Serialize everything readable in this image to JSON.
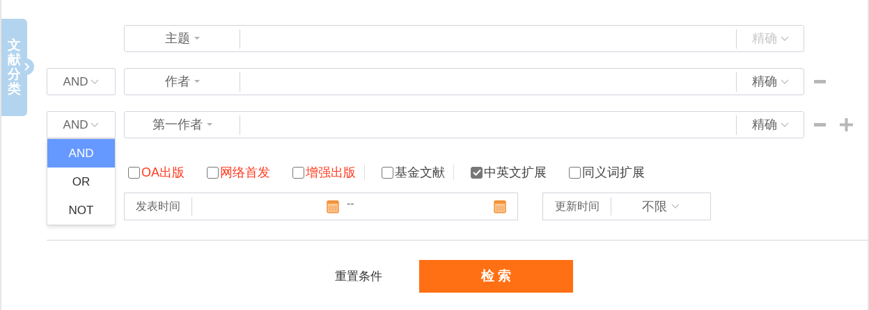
{
  "side_tab": {
    "label": "文献分类"
  },
  "rows": [
    {
      "field": "主题",
      "match": "精确",
      "match_disabled": true,
      "removable": false,
      "addable": false
    },
    {
      "logic": "AND",
      "field": "作者",
      "match": "精确",
      "match_disabled": false,
      "removable": true,
      "addable": false
    },
    {
      "logic": "AND",
      "field": "第一作者",
      "match": "精确",
      "match_disabled": false,
      "removable": true,
      "addable": true,
      "logic_options": [
        {
          "label": "AND",
          "selected": true
        },
        {
          "label": "OR",
          "selected": false
        },
        {
          "label": "NOT",
          "selected": false
        }
      ]
    }
  ],
  "filter_groups": [
    [
      {
        "label": "OA出版",
        "checked": false,
        "highlighted": true
      },
      {
        "label": "网络首发",
        "checked": false,
        "highlighted": true
      },
      {
        "label": "增强出版",
        "checked": false,
        "highlighted": true
      }
    ],
    [
      {
        "label": "基金文献",
        "checked": false,
        "highlighted": false
      }
    ],
    [
      {
        "label": "中英文扩展",
        "checked": true,
        "highlighted": false
      },
      {
        "label": "同义词扩展",
        "checked": false,
        "highlighted": false
      }
    ]
  ],
  "publish_time": {
    "label": "发表时间",
    "separator": "--"
  },
  "update_time": {
    "label": "更新时间",
    "value": "不限"
  },
  "buttons": {
    "reset": "重置条件",
    "search": "检 索"
  }
}
